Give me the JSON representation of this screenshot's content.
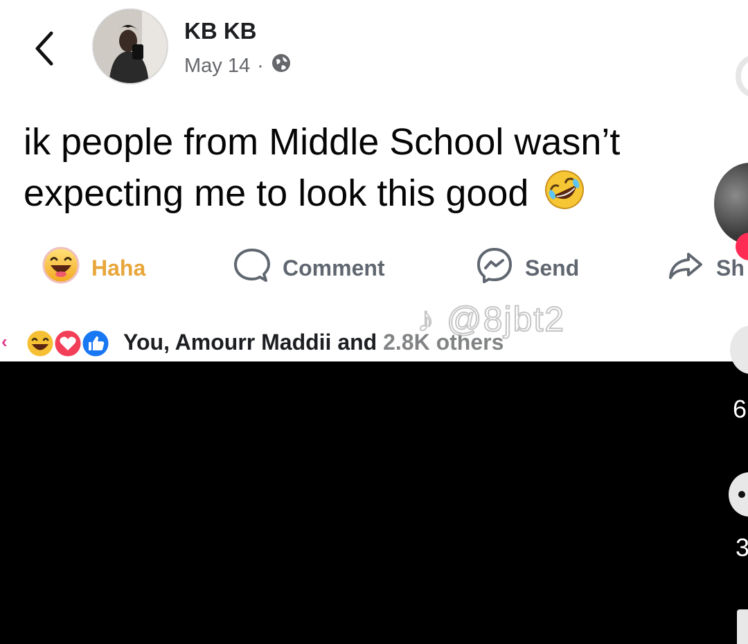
{
  "post": {
    "author": "KB KB",
    "date": "May 14",
    "date_separator": "·",
    "text_line1": "ik people from Middle School wasn’t",
    "text_line2": "expecting me to look this good",
    "text_emoji_icon": "rolling-on-floor-laughing-icon"
  },
  "actions": {
    "haha_label": "Haha",
    "comment_label": "Comment",
    "send_label": "Send",
    "share_label": "Sh"
  },
  "reactions": {
    "summary": "You, Amourr Maddii and ",
    "partial_count": "2.8K others",
    "icons": [
      "haha-icon",
      "love-icon",
      "like-icon"
    ]
  },
  "watermark": "@8jbt2",
  "side_panel": {
    "count1": "6",
    "count2": "3"
  },
  "colors": {
    "haha_accent": "#e8a63a",
    "like_blue": "#1877f2",
    "love_pink": "#f33e58",
    "tiktok_red": "#fe2c55"
  }
}
